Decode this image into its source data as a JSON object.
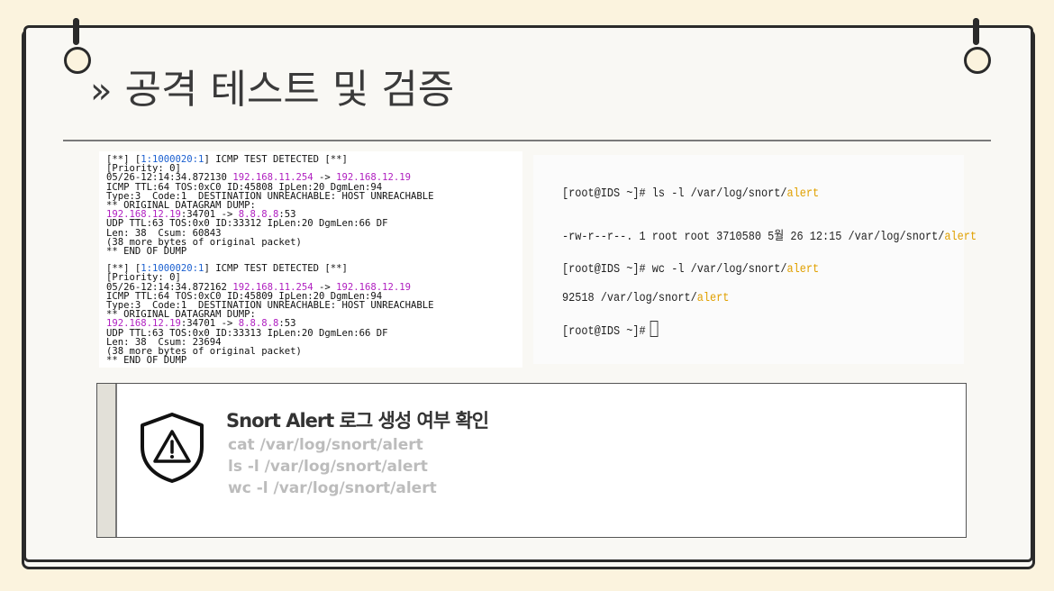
{
  "header": {
    "chevron": "»",
    "title": "공격 테스트 및 검증"
  },
  "snort_log": {
    "blocks": [
      {
        "lines": [
          {
            "parts": [
              {
                "t": "[**] ["
              },
              {
                "t": "1:1000020:1",
                "c": "sid"
              },
              {
                "t": "] ICMP TEST DETECTED [**]"
              }
            ]
          },
          {
            "parts": [
              {
                "t": "[Priority: 0]"
              }
            ]
          },
          {
            "parts": [
              {
                "t": "05/26-12:14:34.872130 "
              },
              {
                "t": "192.168.11.254",
                "c": "ip"
              },
              {
                "t": " -> "
              },
              {
                "t": "192.168.12.19",
                "c": "ip"
              }
            ]
          },
          {
            "parts": [
              {
                "t": "ICMP TTL:64 TOS:0xC0 ID:45808 IpLen:20 DgmLen:94"
              }
            ]
          },
          {
            "parts": [
              {
                "t": "Type:3  Code:1  DESTINATION UNREACHABLE: HOST UNREACHABLE"
              }
            ]
          },
          {
            "parts": [
              {
                "t": "** ORIGINAL DATAGRAM DUMP:"
              }
            ]
          },
          {
            "parts": [
              {
                "t": "192.168.12.19",
                "c": "ip"
              },
              {
                "t": ":34701 -> "
              },
              {
                "t": "8.8.8.8",
                "c": "ip"
              },
              {
                "t": ":53"
              }
            ]
          },
          {
            "parts": [
              {
                "t": "UDP TTL:63 TOS:0x0 ID:33312 IpLen:20 DgmLen:66 DF"
              }
            ]
          },
          {
            "parts": [
              {
                "t": "Len: 38  Csum: 60843"
              }
            ]
          },
          {
            "parts": [
              {
                "t": "(38 more bytes of original packet)"
              }
            ]
          },
          {
            "parts": [
              {
                "t": "** END OF DUMP"
              }
            ]
          }
        ]
      },
      {
        "lines": [
          {
            "parts": [
              {
                "t": "[**] ["
              },
              {
                "t": "1:1000020:1",
                "c": "sid"
              },
              {
                "t": "] ICMP TEST DETECTED [**]"
              }
            ]
          },
          {
            "parts": [
              {
                "t": "[Priority: 0]"
              }
            ]
          },
          {
            "parts": [
              {
                "t": "05/26-12:14:34.872162 "
              },
              {
                "t": "192.168.11.254",
                "c": "ip"
              },
              {
                "t": " -> "
              },
              {
                "t": "192.168.12.19",
                "c": "ip"
              }
            ]
          },
          {
            "parts": [
              {
                "t": "ICMP TTL:64 TOS:0xC0 ID:45809 IpLen:20 DgmLen:94"
              }
            ]
          },
          {
            "parts": [
              {
                "t": "Type:3  Code:1  DESTINATION UNREACHABLE: HOST UNREACHABLE"
              }
            ]
          },
          {
            "parts": [
              {
                "t": "** ORIGINAL DATAGRAM DUMP:"
              }
            ]
          },
          {
            "parts": [
              {
                "t": "192.168.12.19",
                "c": "ip"
              },
              {
                "t": ":34701 -> "
              },
              {
                "t": "8.8.8.8",
                "c": "ip"
              },
              {
                "t": ":53"
              }
            ]
          },
          {
            "parts": [
              {
                "t": "UDP TTL:63 TOS:0x0 ID:33313 IpLen:20 DgmLen:66 DF"
              }
            ]
          },
          {
            "parts": [
              {
                "t": "Len: 38  Csum: 23694"
              }
            ]
          },
          {
            "parts": [
              {
                "t": "(38 more bytes of original packet)"
              }
            ]
          },
          {
            "parts": [
              {
                "t": "** END OF DUMP"
              }
            ]
          }
        ]
      }
    ]
  },
  "terminal": {
    "line1_prefix": "[root@IDS ~]# ls -l /var/log/snort/",
    "line1_hl": "alert",
    "line2_prefix": "-rw-r--r--. 1 root root 3710580 5월 26 12:15 /var/log/snort/",
    "line2_hl": "alert",
    "line3_prefix": "[root@IDS ~]# wc -l /var/log/snort/",
    "line3_hl": "alert",
    "line4_prefix": "92518 /var/log/snort/",
    "line4_hl": "alert",
    "line5_prompt": "[root@IDS ~]#"
  },
  "note": {
    "title": "Snort Alert 로그 생성 여부 확인",
    "commands": [
      "cat /var/log/snort/alert",
      "ls -l /var/log/snort/alert",
      "wc -l /var/log/snort/alert"
    ],
    "icon": "warning-shield-icon"
  },
  "colors": {
    "background": "#fbf3de",
    "ip_highlight": "#b020c0",
    "sid_highlight": "#1a5fd0",
    "terminal_highlight": "#e0a000",
    "note_command": "#bcbcbc"
  }
}
